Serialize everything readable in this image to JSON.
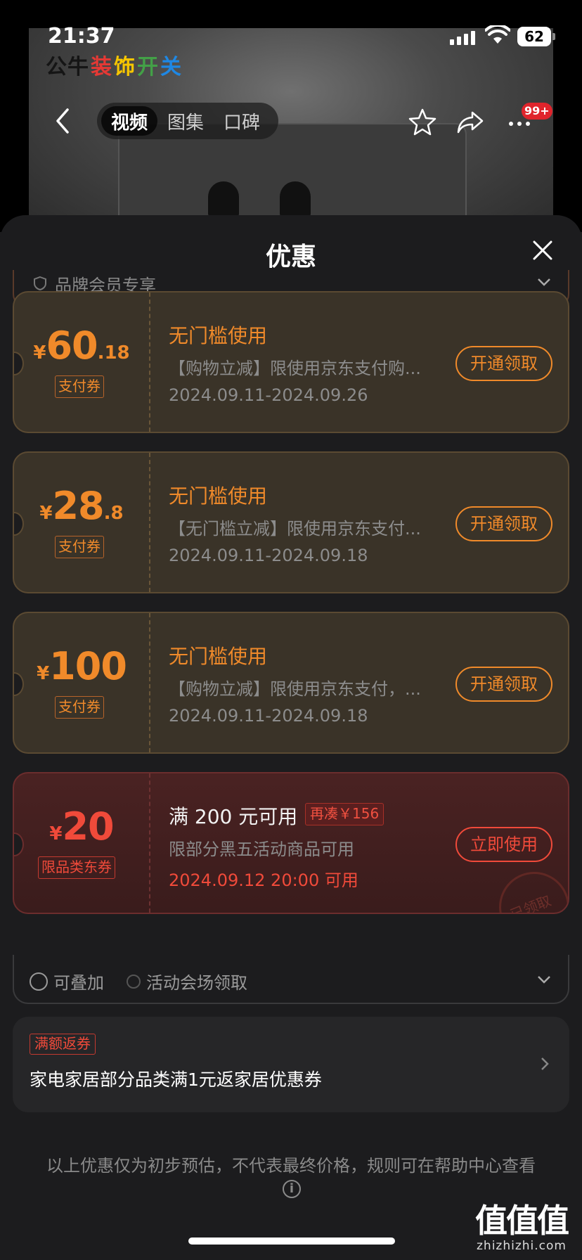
{
  "status_bar": {
    "time": "21:37",
    "battery": "62"
  },
  "product": {
    "brand_logo": [
      "公牛",
      "装",
      "饰",
      "开",
      "关"
    ],
    "brand_colors": [
      "#111111",
      "#e53935",
      "#f7c600",
      "#43a047",
      "#1e88e5"
    ]
  },
  "nav": {
    "tabs": [
      {
        "label": "视频",
        "active": true
      },
      {
        "label": "图集",
        "active": false
      },
      {
        "label": "口碑",
        "active": false
      }
    ],
    "badge": "99+"
  },
  "sheet": {
    "title": "优惠",
    "member_row": "品牌会员专享",
    "coupons": [
      {
        "currency": "¥",
        "amount_int": "60",
        "amount_dec": ".18",
        "tag": "支付券",
        "title": "无门槛使用",
        "desc": "【购物立减】限使用京东支付购...",
        "date": "2024.09.11-2024.09.26",
        "button": "开通领取"
      },
      {
        "currency": "¥",
        "amount_int": "28",
        "amount_dec": ".8",
        "tag": "支付券",
        "title": "无门槛使用",
        "desc": "【无门槛立减】限使用京东支付...",
        "date": "2024.09.11-2024.09.18",
        "button": "开通领取"
      },
      {
        "currency": "¥",
        "amount_int": "100",
        "amount_dec": "",
        "tag": "支付券",
        "title": "无门槛使用",
        "desc": "【购物立减】限使用京东支付，...",
        "date": "2024.09.11-2024.09.18",
        "button": "开通领取"
      },
      {
        "currency": "¥",
        "amount_int": "20",
        "amount_dec": "",
        "tag": "限品类东券",
        "title": "满 200 元可用",
        "extra_tag": "再凑￥156",
        "desc": "限部分黑五活动商品可用",
        "date": "2024.09.12 20:00 可用",
        "button": "立即使用",
        "stamp": "已领取"
      }
    ],
    "stack_row": {
      "stackable": "可叠加",
      "source": "活动会场领取"
    },
    "rebate": {
      "tag": "满额返券",
      "text": "家电家居部分品类满1元返家居优惠券"
    },
    "disclaimer": "以上优惠仅为初步预估，不代表最终价格，规则可在帮助中心查看",
    "info_glyph": "i"
  },
  "watermark": {
    "big": "值值值",
    "small": "zhizhizhi.com"
  },
  "colors": {
    "accent_orange": "#f08a2a",
    "accent_red": "#f04a3a",
    "sheet_bg": "#1c1c1e"
  }
}
